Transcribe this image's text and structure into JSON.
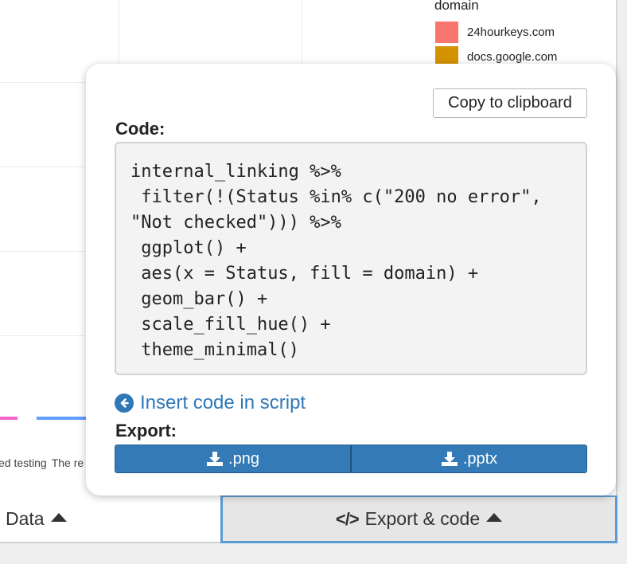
{
  "legend": {
    "title": "domain",
    "items": [
      {
        "label": "24hourkeys.com",
        "color": "#f8766d"
      },
      {
        "label": "docs.google.com",
        "color": "#d39200"
      }
    ]
  },
  "axis": {
    "labels": [
      "ed testing",
      "The re"
    ]
  },
  "popover": {
    "copy_label": "Copy to clipboard",
    "code_label": "Code:",
    "code": "internal_linking %>%\n filter(!(Status %in% c(\"200 no error\", \"Not checked\"))) %>%\n ggplot() +\n aes(x = Status, fill = domain) +\n geom_bar() +\n scale_fill_hue() +\n theme_minimal()",
    "insert_label": "Insert code in script",
    "export_label": "Export:",
    "export_png": ".png",
    "export_pptx": ".pptx"
  },
  "tabs": {
    "data_label": "Data",
    "export_label": "Export & code"
  },
  "colors": {
    "accent": "#337ab7",
    "link": "#2f78b8",
    "bar_pink": "#f365c8",
    "bar_blue": "#619cff"
  }
}
